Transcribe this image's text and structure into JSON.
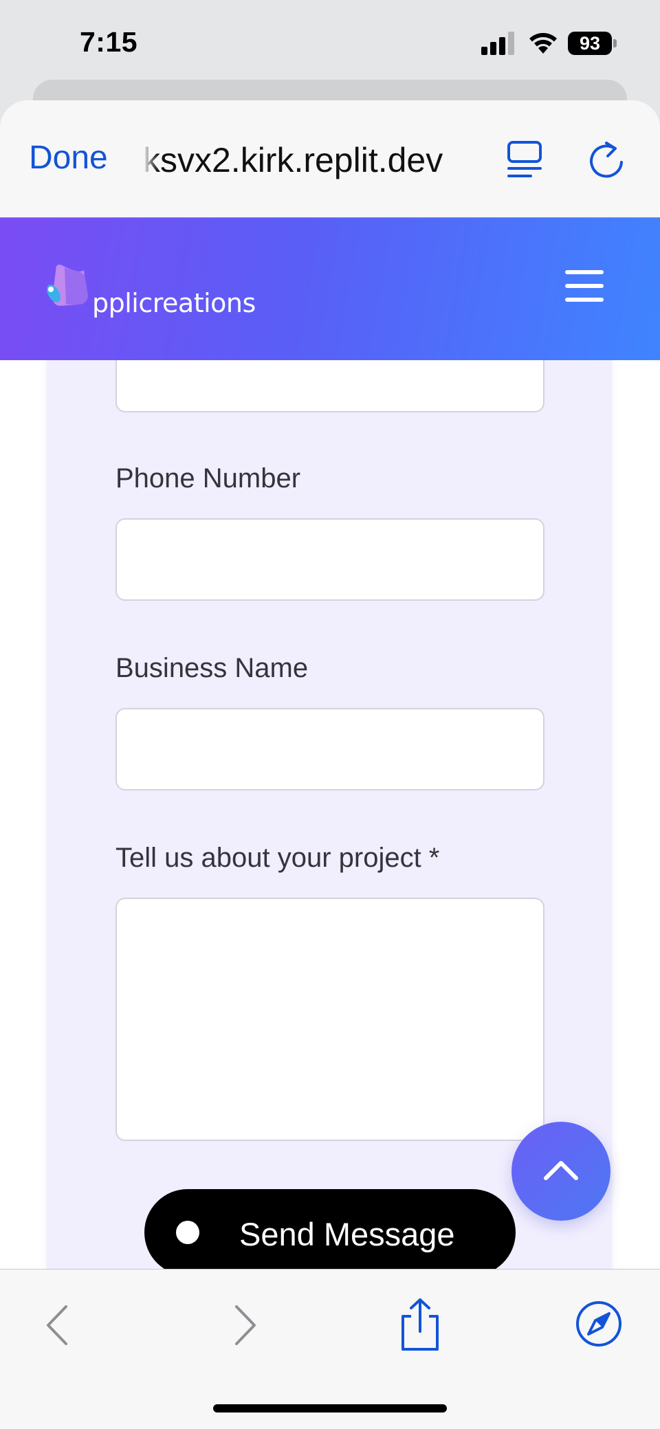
{
  "status_bar": {
    "time": "7:15",
    "battery_level": "93",
    "icons": [
      "signal-icon",
      "wifi-icon",
      "battery-icon"
    ]
  },
  "browser": {
    "done_label": "Done",
    "url": "ksvx2.kirk.replit.dev",
    "icons": [
      "reader-icon",
      "reload-icon"
    ],
    "accent_color": "#1254d8"
  },
  "site": {
    "logo_text": "pplicreations",
    "menu_icon": "hamburger-menu-icon",
    "header_gradient": [
      "#7a4cf4",
      "#3f84ff"
    ]
  },
  "form": {
    "background_color": "#f1eefe",
    "fields": [
      {
        "label": "Phone Number",
        "value": ""
      },
      {
        "label": "Business Name",
        "value": ""
      },
      {
        "label": "Tell us about your project *",
        "value": ""
      }
    ],
    "submit_label": "Send Message"
  },
  "toolbar": {
    "icons": [
      "back-icon",
      "forward-icon",
      "share-icon",
      "compass-icon"
    ]
  }
}
